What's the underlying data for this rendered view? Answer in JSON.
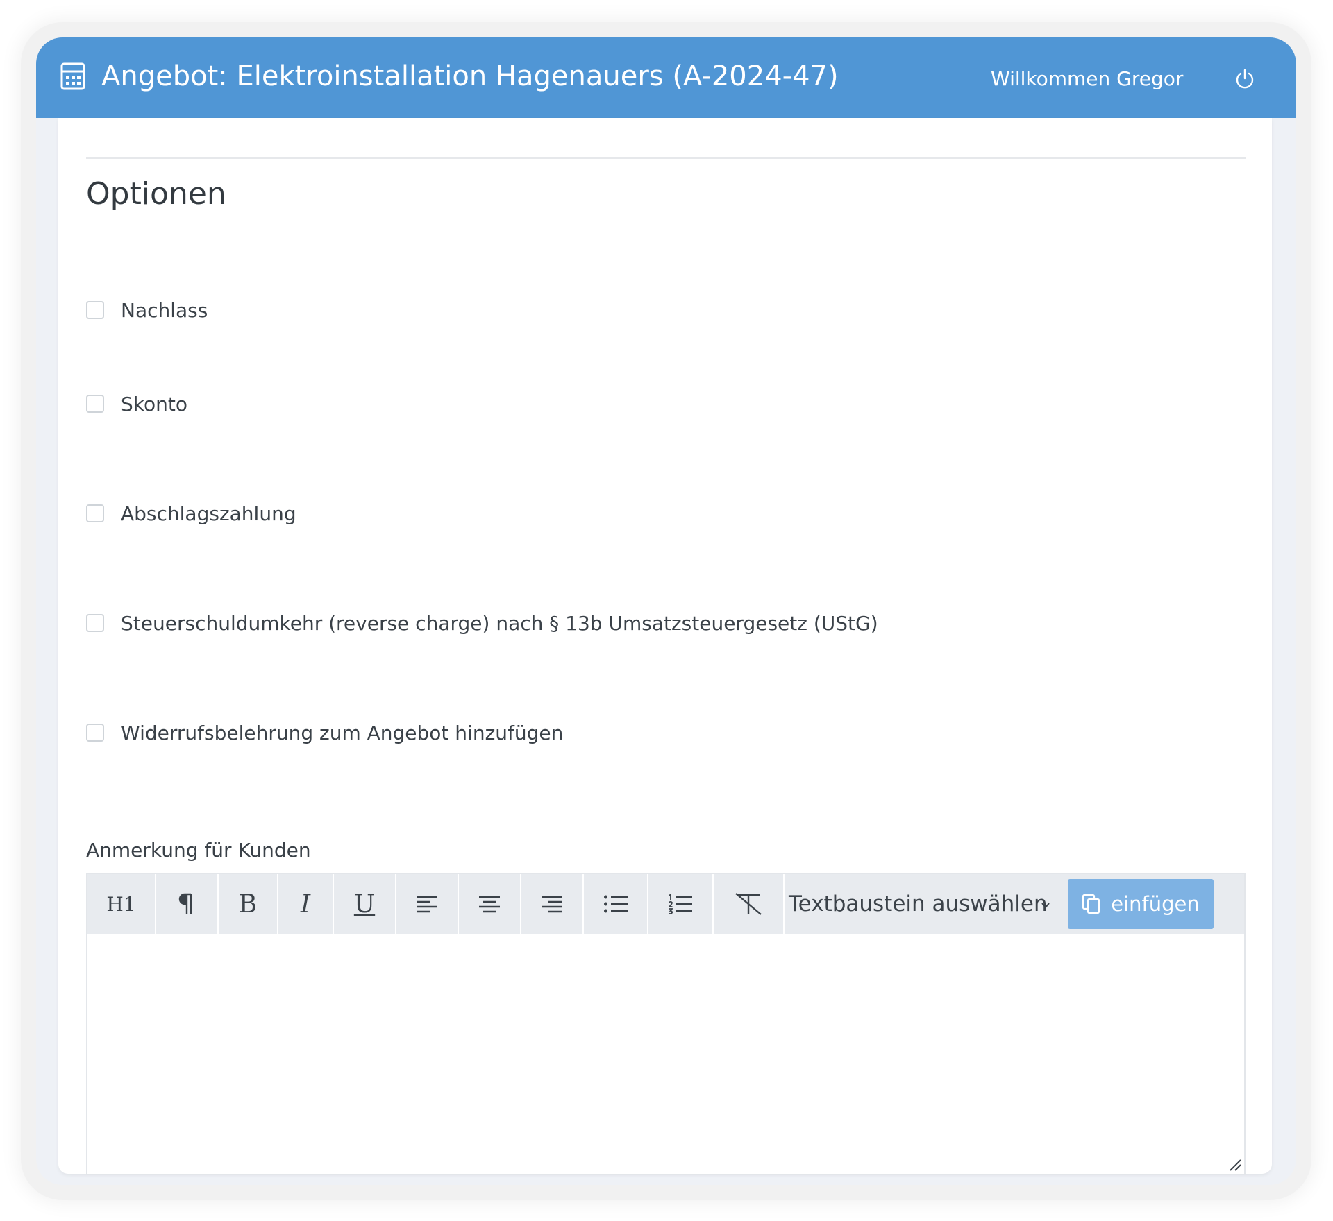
{
  "header": {
    "app_icon": "calculator-icon",
    "title": "Angebot: Elektroinstallation Hagenauers (A-2024-47)",
    "welcome": "Willkommen Gregor",
    "logout_icon": "power-icon",
    "background_color": "#5096d5"
  },
  "section": {
    "title": "Optionen"
  },
  "options": [
    {
      "label": "Nachlass",
      "checked": false
    },
    {
      "label": "Skonto",
      "checked": false
    },
    {
      "label": "Abschlagszahlung",
      "checked": false
    },
    {
      "label": "Steuerschuldumkehr (reverse charge) nach § 13b Umsatzsteuergesetz (UStG)",
      "checked": false
    },
    {
      "label": "Widerrufsbelehrung zum Angebot hinzufügen",
      "checked": false
    }
  ],
  "note": {
    "label": "Anmerkung für Kunden",
    "value": ""
  },
  "toolbar": {
    "heading_label": "H1",
    "paragraph_icon": "paragraph-icon",
    "bold_label": "B",
    "italic_label": "I",
    "underline_label": "U",
    "align_left_icon": "align-left-icon",
    "align_center_icon": "align-center-icon",
    "align_right_icon": "align-right-icon",
    "bullet_list_icon": "bullet-list-icon",
    "ordered_list_icon": "ordered-list-icon",
    "clear_format_icon": "clear-format-icon",
    "snippet_select_value": "Textbaustein auswählen",
    "insert_label": "einfügen",
    "insert_icon": "copy-icon",
    "insert_color": "#7eb2e3"
  }
}
